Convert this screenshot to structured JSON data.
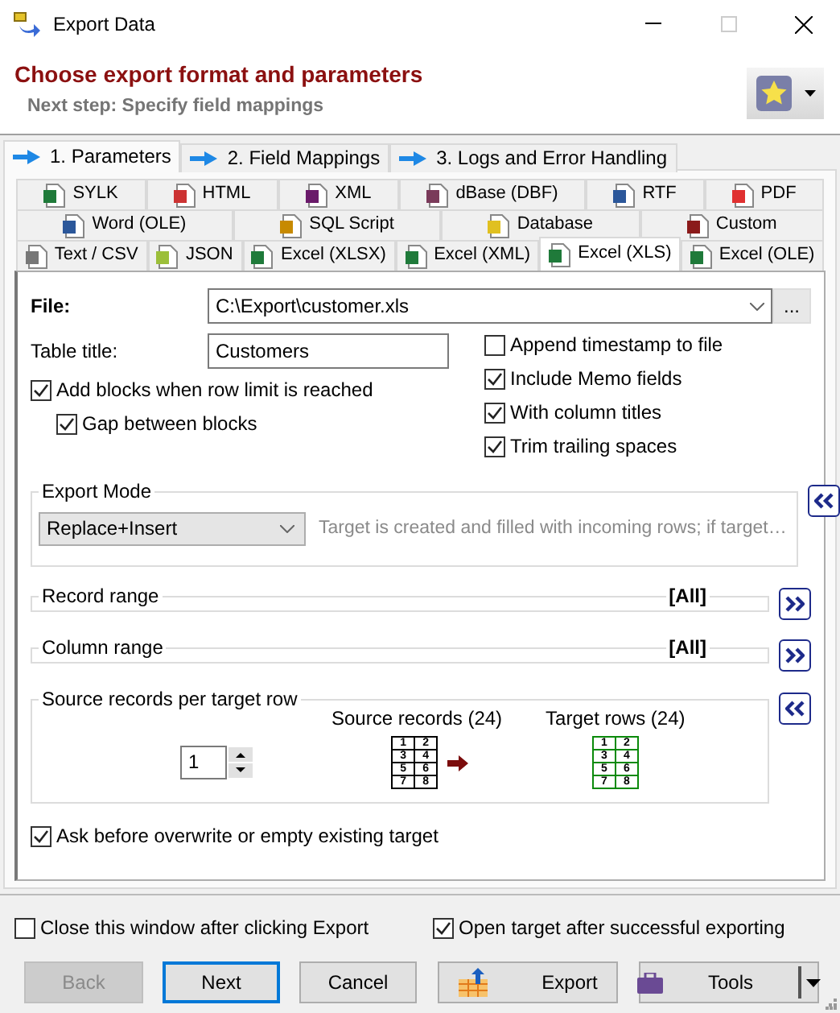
{
  "window": {
    "title": "Export Data"
  },
  "header": {
    "title": "Choose export format and parameters",
    "subtitle": "Next step: Specify field mappings"
  },
  "steps": [
    {
      "label": "1. Parameters",
      "selected": true
    },
    {
      "label": "2. Field Mappings",
      "selected": false
    },
    {
      "label": "3. Logs and Error Handling",
      "selected": false
    }
  ],
  "format_tabs": [
    [
      {
        "label": "SYLK",
        "selected": false
      },
      {
        "label": "HTML",
        "selected": false
      },
      {
        "label": "XML",
        "selected": false
      },
      {
        "label": "dBase (DBF)",
        "selected": false
      },
      {
        "label": "RTF",
        "selected": false
      },
      {
        "label": "PDF",
        "selected": false
      }
    ],
    [
      {
        "label": "Word (OLE)",
        "selected": false
      },
      {
        "label": "SQL Script",
        "selected": false
      },
      {
        "label": "Database",
        "selected": false
      },
      {
        "label": "Custom",
        "selected": false
      }
    ],
    [
      {
        "label": "Text / CSV",
        "selected": false
      },
      {
        "label": "JSON",
        "selected": false
      },
      {
        "label": "Excel (XLSX)",
        "selected": false
      },
      {
        "label": "Excel (XML)",
        "selected": false
      },
      {
        "label": "Excel (XLS)",
        "selected": true
      },
      {
        "label": "Excel (OLE)",
        "selected": false
      }
    ]
  ],
  "file": {
    "label": "File:",
    "value": "C:\\Export\\customer.xls",
    "browse": "..."
  },
  "table_title": {
    "label": "Table title:",
    "value": "Customers"
  },
  "left_options": [
    {
      "label": "Add blocks when row limit is reached",
      "checked": true,
      "children": [
        {
          "label": "Gap between blocks",
          "checked": true
        }
      ]
    }
  ],
  "right_options": [
    {
      "label": "Append timestamp to file",
      "checked": false
    },
    {
      "label": "Include Memo fields",
      "checked": true
    },
    {
      "label": "With column titles",
      "checked": true
    },
    {
      "label": "Trim trailing spaces",
      "checked": true
    }
  ],
  "export_mode": {
    "title": "Export Mode",
    "expanded": true,
    "value": "Replace+Insert",
    "description": "Target is created and filled with incoming rows; if target…"
  },
  "ranges": [
    {
      "title": "Record range",
      "value": "[All]",
      "expanded": false
    },
    {
      "title": "Column range",
      "value": "[All]",
      "expanded": false
    }
  ],
  "records_per_row": {
    "title": "Source records per target row",
    "expanded": true,
    "value": "1",
    "source_label": "Source records (24)",
    "target_label": "Target rows (24)",
    "source_cells": [
      "1",
      "2",
      "3",
      "4",
      "5",
      "6",
      "7",
      "8"
    ],
    "target_cells": [
      "1",
      "2",
      "3",
      "4",
      "5",
      "6",
      "7",
      "8"
    ]
  },
  "ask_overwrite": {
    "label": "Ask before overwrite or empty existing target",
    "checked": true
  },
  "footer_options": [
    {
      "label": "Close this window after clicking Export",
      "checked": false
    },
    {
      "label": "Open target after successful exporting",
      "checked": true
    }
  ],
  "buttons": [
    {
      "label": "Back",
      "kind": "back",
      "disabled": true,
      "default": false
    },
    {
      "label": "Next",
      "kind": "next",
      "disabled": false,
      "default": true
    },
    {
      "label": "Cancel",
      "kind": "cancel",
      "disabled": false,
      "default": false
    },
    {
      "label": "Export",
      "kind": "export",
      "disabled": false,
      "default": false
    },
    {
      "label": "Tools",
      "kind": "tools",
      "disabled": false,
      "default": false
    }
  ]
}
